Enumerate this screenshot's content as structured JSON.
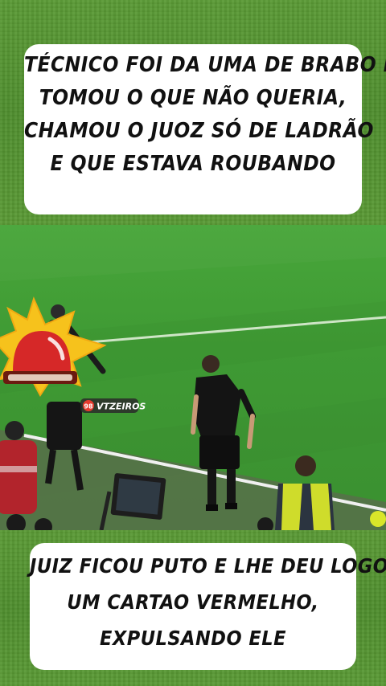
{
  "caption_top": {
    "lines": [
      "TÉCNICO FOI DA UMA DE BRABO E",
      "TOMOU O QUE NÃO QUERIA,",
      "CHAMOU O JUOZ SÓ DE LADRÃO",
      "E QUE ESTAVA ROUBANDO"
    ]
  },
  "caption_bottom": {
    "lines": [
      "JUIZ FICOU PUTO E LHE DEU LOGO",
      "UM CARTAO VERMELHO,",
      "EXPULSANDO  ELE"
    ]
  },
  "watermark": {
    "badge": "98",
    "text": "VTZEIROS"
  },
  "colors": {
    "grass": "#4f8e2e",
    "siren_red": "#d62828",
    "burst_yellow": "#f6c21c",
    "referee_black": "#111111",
    "steward_vest": "#d8e62a"
  },
  "icons": {
    "siren": "siren-icon"
  }
}
